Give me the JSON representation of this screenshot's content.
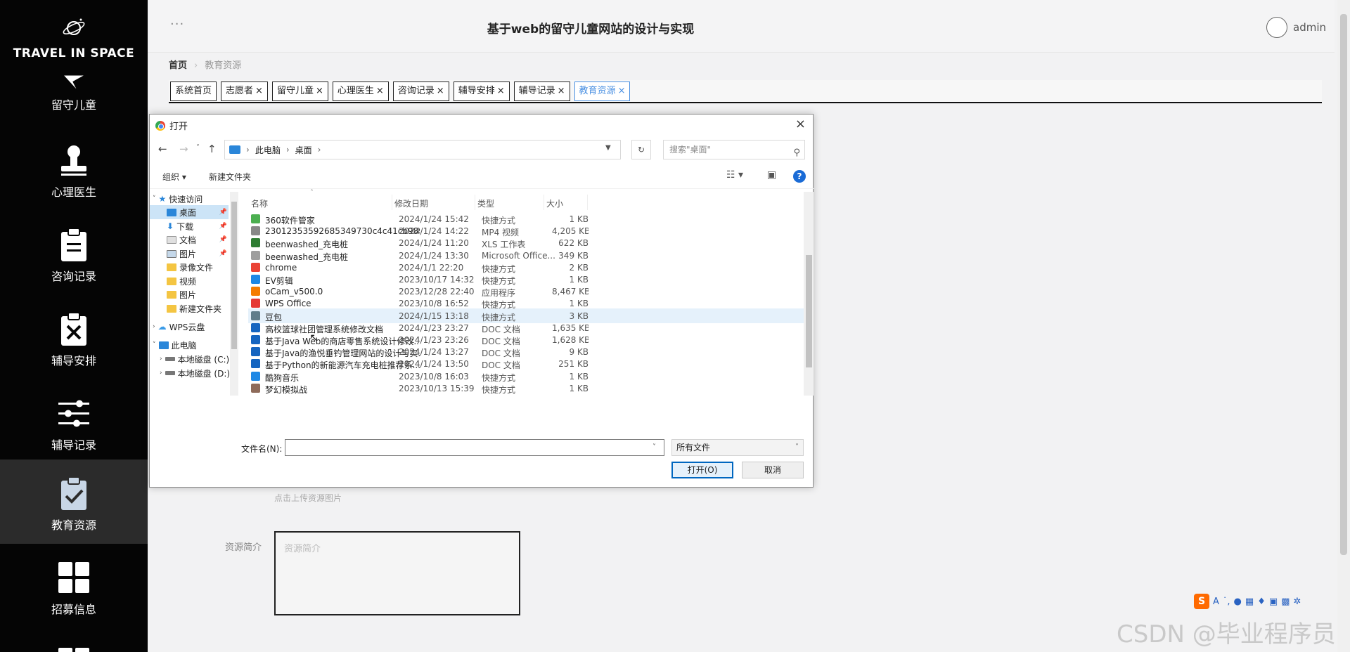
{
  "brand": {
    "name": "TRAVEL IN SPACE"
  },
  "sidebar": {
    "items": [
      {
        "label": "留守儿童",
        "icon": "flag-icon"
      },
      {
        "label": "心理医生",
        "icon": "stamp-icon"
      },
      {
        "label": "咨询记录",
        "icon": "clipboard-icon"
      },
      {
        "label": "辅导安排",
        "icon": "clipboard-x-icon"
      },
      {
        "label": "辅导记录",
        "icon": "sliders-icon"
      },
      {
        "label": "教育资源",
        "icon": "clipboard-check-icon",
        "active": true
      },
      {
        "label": "招募信息",
        "icon": "grid-icon"
      }
    ]
  },
  "header": {
    "dots": "···",
    "title": "基于web的留守儿童网站的设计与实现",
    "user": "admin"
  },
  "breadcrumb": {
    "home": "首页",
    "current": "教育资源"
  },
  "tabs": [
    {
      "label": "系统首页",
      "closable": false
    },
    {
      "label": "志愿者",
      "closable": true
    },
    {
      "label": "留守儿童",
      "closable": true
    },
    {
      "label": "心理医生",
      "closable": true
    },
    {
      "label": "咨询记录",
      "closable": true
    },
    {
      "label": "辅导安排",
      "closable": true
    },
    {
      "label": "辅导记录",
      "closable": true
    },
    {
      "label": "教育资源",
      "closable": true,
      "active": true
    }
  ],
  "form": {
    "upload_hint": "点击上传资源图片",
    "intro_label": "资源简介",
    "intro_placeholder": "资源简介"
  },
  "dialog": {
    "title": "打开",
    "close": "×",
    "address": {
      "root": "此电脑",
      "folder": "桌面"
    },
    "search_placeholder": "搜索\"桌面\"",
    "toolbar": {
      "organize": "组织 ▾",
      "new_folder": "新建文件夹"
    },
    "tree": [
      {
        "label": "快速访问",
        "level": 0,
        "icon": "star-icon",
        "expanded": true
      },
      {
        "label": "桌面",
        "level": 1,
        "icon": "desktop-icon",
        "pinned": true,
        "selected": true
      },
      {
        "label": "下载",
        "level": 1,
        "icon": "download-icon",
        "pinned": true
      },
      {
        "label": "文档",
        "level": 1,
        "icon": "document-icon",
        "pinned": true
      },
      {
        "label": "图片",
        "level": 1,
        "icon": "picture-icon",
        "pinned": true
      },
      {
        "label": "录像文件",
        "level": 1,
        "icon": "folder-icon"
      },
      {
        "label": "视频",
        "level": 1,
        "icon": "folder-icon"
      },
      {
        "label": "图片",
        "level": 1,
        "icon": "folder-icon"
      },
      {
        "label": "新建文件夹",
        "level": 1,
        "icon": "folder-icon"
      },
      {
        "label": "WPS云盘",
        "level": 0,
        "icon": "cloud-icon",
        "expanded": false
      },
      {
        "label": "此电脑",
        "level": 0,
        "icon": "computer-icon",
        "expanded": true
      },
      {
        "label": "本地磁盘 (C:)",
        "level": 1,
        "icon": "drive-icon"
      },
      {
        "label": "本地磁盘 (D:)",
        "level": 1,
        "icon": "drive-icon"
      }
    ],
    "columns": [
      "名称",
      "修改日期",
      "类型",
      "大小"
    ],
    "files": [
      {
        "name": "360软件管家",
        "date": "2024/1/24 15:42",
        "type": "快捷方式",
        "size": "1 KB",
        "color": "#4caf50"
      },
      {
        "name": "23012353592685349730c4c41cb98991",
        "date": "2024/1/24 14:22",
        "type": "MP4 视频",
        "size": "4,205 KB",
        "color": "#888888"
      },
      {
        "name": "beenwashed_充电桩",
        "date": "2024/1/24 11:20",
        "type": "XLS 工作表",
        "size": "622 KB",
        "color": "#2e7d32"
      },
      {
        "name": "beenwashed_充电桩",
        "date": "2024/1/24 13:30",
        "type": "Microsoft Office...",
        "size": "349 KB",
        "color": "#9e9e9e"
      },
      {
        "name": "chrome",
        "date": "2024/1/1 22:20",
        "type": "快捷方式",
        "size": "2 KB",
        "color": "#ea4335"
      },
      {
        "name": "EV剪辑",
        "date": "2023/10/17 14:32",
        "type": "快捷方式",
        "size": "1 KB",
        "color": "#1e88e5"
      },
      {
        "name": "oCam_v500.0",
        "date": "2023/12/28 22:40",
        "type": "应用程序",
        "size": "8,467 KB",
        "color": "#f57c00"
      },
      {
        "name": "WPS Office",
        "date": "2023/10/8 16:52",
        "type": "快捷方式",
        "size": "1 KB",
        "color": "#e53935"
      },
      {
        "name": "豆包",
        "date": "2024/1/15 13:18",
        "type": "快捷方式",
        "size": "3 KB",
        "color": "#607d8b",
        "hover": true
      },
      {
        "name": "高校篮球社团管理系统修改文档",
        "date": "2024/1/23 23:27",
        "type": "DOC 文档",
        "size": "1,635 KB",
        "color": "#1565c0"
      },
      {
        "name": "基于Java Web的商店零售系统设计修改...",
        "date": "2024/1/23 23:26",
        "type": "DOC 文档",
        "size": "1,628 KB",
        "color": "#1565c0"
      },
      {
        "name": "基于Java的渔悦垂钓管理网站的设计与实...",
        "date": "2024/1/24 13:27",
        "type": "DOC 文档",
        "size": "9 KB",
        "color": "#1565c0"
      },
      {
        "name": "基于Python的新能源汽车充电桩推荐系...",
        "date": "2024/1/24 13:50",
        "type": "DOC 文档",
        "size": "251 KB",
        "color": "#1565c0"
      },
      {
        "name": "酷狗音乐",
        "date": "2023/10/8 16:03",
        "type": "快捷方式",
        "size": "1 KB",
        "color": "#1e88e5"
      },
      {
        "name": "梦幻模拟战",
        "date": "2023/10/13 15:39",
        "type": "快捷方式",
        "size": "1 KB",
        "color": "#8e6b5a"
      }
    ],
    "filename_label": "文件名(N):",
    "filename_value": "",
    "filter": "所有文件",
    "open_button": "打开(O)",
    "cancel_button": "取消"
  },
  "ime": {
    "logo": "S",
    "glyph": "A"
  },
  "watermark": "CSDN @毕业程序员"
}
